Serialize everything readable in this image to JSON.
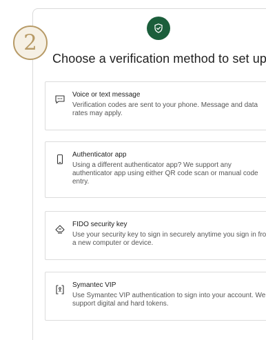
{
  "step_number": "2",
  "page_title": "Choose a verification method to set up",
  "icons": {
    "header": "shield-check-icon",
    "accent_color": "#1b5e3b",
    "badge_color": "#b79a66"
  },
  "options": [
    {
      "icon": "message-bubble-icon",
      "title": "Voice or text message",
      "description": "Verification codes are sent to your phone. Message and data rates may apply."
    },
    {
      "icon": "smartphone-icon",
      "title": "Authenticator app",
      "description": "Using a different authenticator app? We support any authenticator app using either QR code scan or manual code entry."
    },
    {
      "icon": "security-key-icon",
      "title": "FIDO security key",
      "description": "Use your security key to sign in securely anytime you sign in from a new computer or device."
    },
    {
      "icon": "symantec-vip-icon",
      "title": "Symantec VIP",
      "description": "Use Symantec VIP authentication to sign into your account. We support digital and hard tokens."
    }
  ]
}
